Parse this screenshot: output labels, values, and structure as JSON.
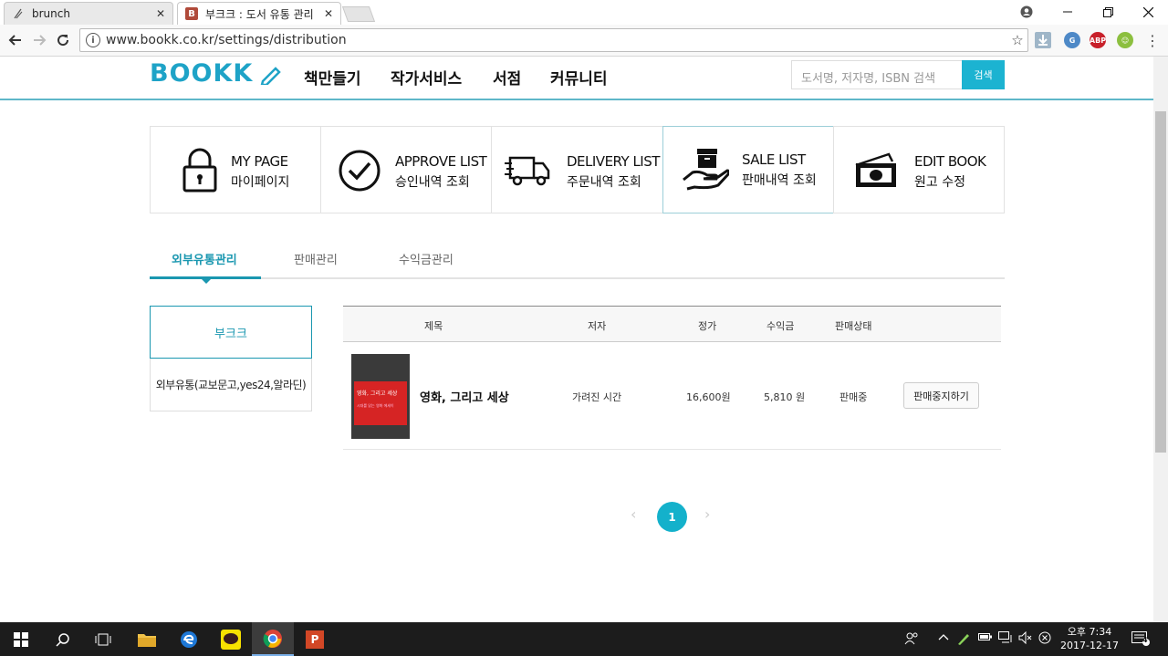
{
  "browser": {
    "tabs": [
      {
        "title": "brunch",
        "icon": "brunch-favicon"
      },
      {
        "title": "부크크 : 도서 유통 관리",
        "icon": "bookk-favicon",
        "favicon_letter": "B"
      }
    ],
    "url": "www.bookk.co.kr/settings/distribution"
  },
  "site": {
    "logo": "BOOKK",
    "nav": [
      "책만들기",
      "작가서비스",
      "서점",
      "커뮤니티"
    ],
    "search_placeholder": "도서명, 저자명, ISBN 검색",
    "search_button": "검색"
  },
  "menu": [
    {
      "en": "MY PAGE",
      "ko": "마이페이지",
      "icon": "lock-icon"
    },
    {
      "en": "APPROVE LIST",
      "ko": "승인내역 조회",
      "icon": "check-circle-icon"
    },
    {
      "en": "DELIVERY LIST",
      "ko": "주문내역 조회",
      "icon": "truck-icon"
    },
    {
      "en": "SALE LIST",
      "ko": "판매내역 조회",
      "icon": "box-hand-icon"
    },
    {
      "en": "EDIT BOOK",
      "ko": "원고 수정",
      "icon": "money-icon"
    }
  ],
  "subtabs": [
    "외부유통관리",
    "판매관리",
    "수익금관리"
  ],
  "side": [
    "부크크",
    "외부유통(교보문고,yes24,알라딘)"
  ],
  "table": {
    "headers": [
      "제목",
      "저자",
      "정가",
      "수익금",
      "판매상태"
    ],
    "rows": [
      {
        "cover_title": "영화, 그리고 세상",
        "cover_sub": "시대를 읽는 영화 에세이",
        "title": "영화, 그리고 세상",
        "author": "가려진 시간",
        "price": "16,600원",
        "revenue": "5,810 원",
        "status": "판매중",
        "action": "판매중지하기"
      }
    ]
  },
  "pagination": {
    "current": "1",
    "prev": "‹",
    "next": "›"
  },
  "taskbar": {
    "time": "오후 7:34",
    "date": "2017-12-17",
    "notifications": "4",
    "ppt_label": "P"
  },
  "colors": {
    "accent": "#1ea3c7",
    "button": "#1cb3d1",
    "taskbar": "#1c1c1c"
  }
}
